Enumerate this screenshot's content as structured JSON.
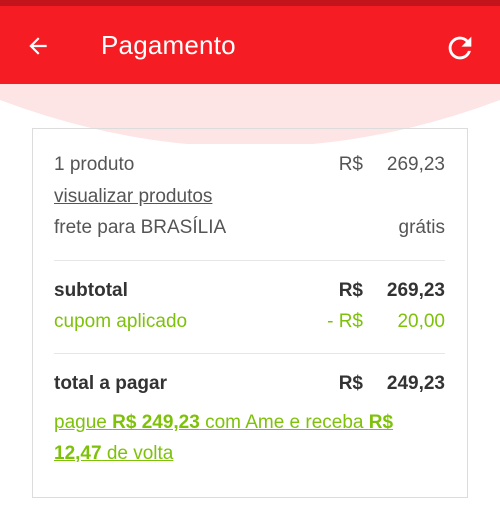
{
  "header": {
    "title": "Pagamento",
    "back_icon": "arrow-left-icon",
    "refresh_icon": "refresh-icon",
    "color": "#f51c23"
  },
  "summary": {
    "products_label": "1 produto",
    "products_currency": "R$",
    "products_value": "269,23",
    "view_products_link": "visualizar produtos",
    "shipping_label": "frete para BRASÍLIA",
    "shipping_value": "grátis",
    "subtotal_label": "subtotal",
    "subtotal_currency": "R$",
    "subtotal_value": "269,23",
    "coupon_label": "cupom aplicado",
    "coupon_currency": "- R$",
    "coupon_value": "20,00",
    "total_label": "total a pagar",
    "total_currency": "R$",
    "total_value": "249,23"
  },
  "ame_offer": {
    "prefix": "pague ",
    "amount": "R$ 249,23",
    "middle": " com Ame e receba ",
    "cashback": "R$ 12,47",
    "suffix": " de volta",
    "accent_color": "#7ec10a"
  }
}
